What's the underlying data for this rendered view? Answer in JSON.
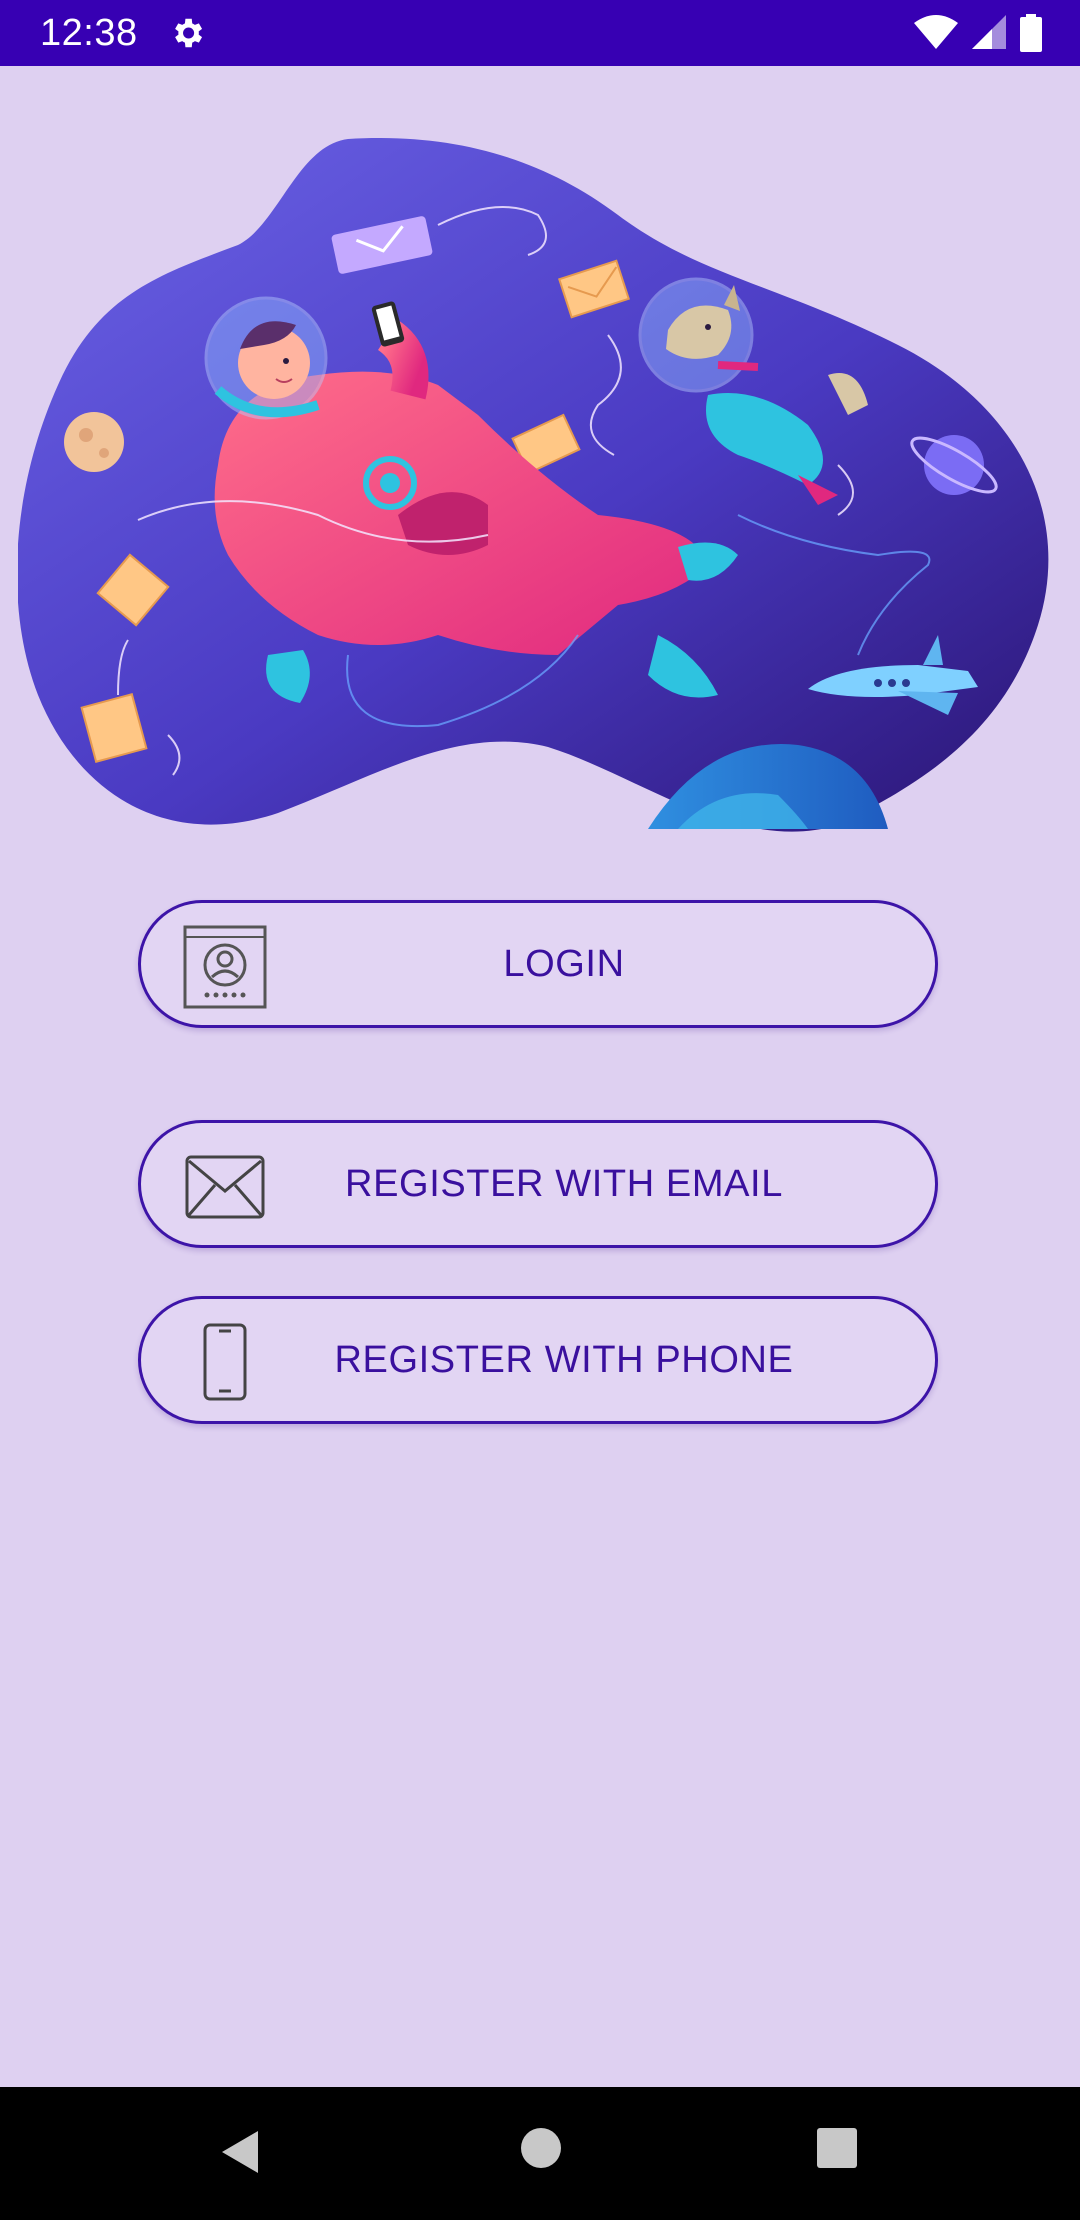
{
  "status_bar": {
    "time": "12:38",
    "icons": [
      "settings-gear-icon",
      "wifi-icon",
      "signal-icon",
      "battery-icon"
    ]
  },
  "hero": {
    "illustration": "astronaut-and-dog-in-space-with-envelopes"
  },
  "buttons": {
    "login": {
      "label": "LOGIN",
      "icon": "contact-card-icon"
    },
    "register_email": {
      "label": "REGISTER WITH EMAIL",
      "icon": "envelope-icon"
    },
    "register_phone": {
      "label": "REGISTER WITH PHONE",
      "icon": "phone-icon"
    }
  },
  "nav_bar": {
    "buttons": [
      "back-icon",
      "home-icon",
      "recents-icon"
    ]
  },
  "colors": {
    "status_bar": "#3700b3",
    "background": "#ded0f1",
    "accent": "#3d14a8",
    "button_text": "#3a109e"
  }
}
